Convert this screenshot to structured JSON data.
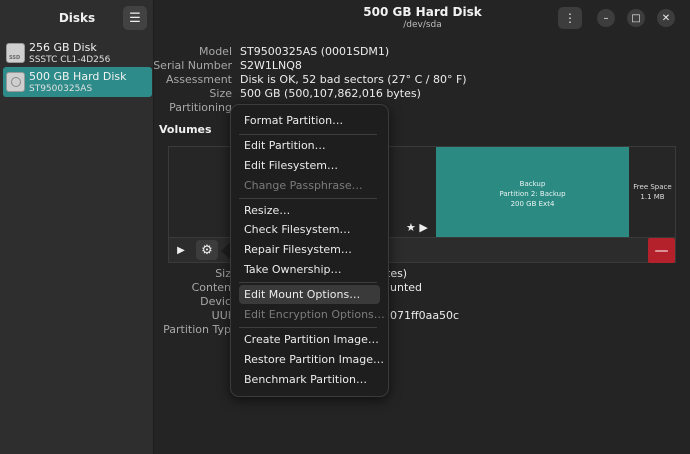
{
  "sidebar": {
    "title": "Disks",
    "menu_icon": "hamburger-icon",
    "disks": [
      {
        "name": "256 GB Disk",
        "model": "SSSTC CL1-4D256",
        "icon": "ssd-drive-icon",
        "selected": false
      },
      {
        "name": "500 GB Hard Disk",
        "model": "ST9500325AS",
        "icon": "hard-disk-icon",
        "selected": true
      }
    ]
  },
  "header": {
    "title": "500 GB Hard Disk",
    "subtitle": "/dev/sda",
    "menu_glyph": "⋮",
    "minimize_glyph": "–",
    "maximize_glyph": "□",
    "close_glyph": "✕"
  },
  "disk_info": [
    {
      "label": "Model",
      "value": "ST9500325AS (0001SDM1)"
    },
    {
      "label": "Serial Number",
      "value": "S2W1LNQ8"
    },
    {
      "label": "Assessment",
      "value": "Disk is OK, 52 bad sectors (27° C / 80° F)"
    },
    {
      "label": "Size",
      "value": "500 GB (500,107,862,016 bytes)"
    },
    {
      "label": "Partitioning",
      "value": ""
    }
  ],
  "volumes": {
    "title": "Volumes",
    "partitions": [
      {
        "name": "Backup",
        "line2": "Partition 2: Backup",
        "line3": "200 GB Ext4",
        "color": "#2b8a82"
      },
      {
        "name": "Free Space",
        "line2": "1.1 MB"
      }
    ],
    "marker_glyphs": "★ ▶",
    "play_glyph": "▶",
    "gear_glyph": "⚙",
    "minus_glyph": "—"
  },
  "partition_details": [
    {
      "label": "Siz",
      "value": "tes)"
    },
    {
      "label": "Conten",
      "value": "unted"
    },
    {
      "label": "Devic",
      "value": ""
    },
    {
      "label": "UUI",
      "value": "071ff0aa50c"
    },
    {
      "label": "Partition Typ",
      "value": ""
    }
  ],
  "context_menu": {
    "items": [
      {
        "label": "Format Partition…",
        "enabled": true
      },
      {
        "label": "Edit Partition…",
        "enabled": true
      },
      {
        "label": "Edit Filesystem…",
        "enabled": true
      },
      {
        "label": "Change Passphrase…",
        "enabled": false
      },
      {
        "label": "Resize…",
        "enabled": true
      },
      {
        "label": "Check Filesystem…",
        "enabled": true
      },
      {
        "label": "Repair Filesystem…",
        "enabled": true
      },
      {
        "label": "Take Ownership…",
        "enabled": true
      },
      {
        "label": "Edit Mount Options…",
        "enabled": true,
        "hover": true
      },
      {
        "label": "Edit Encryption Options…",
        "enabled": false
      },
      {
        "label": "Create Partition Image…",
        "enabled": true
      },
      {
        "label": "Restore Partition Image…",
        "enabled": true
      },
      {
        "label": "Benchmark Partition…",
        "enabled": true
      }
    ]
  },
  "colors": {
    "accent": "#2d8c8a",
    "danger": "#b5212b"
  }
}
